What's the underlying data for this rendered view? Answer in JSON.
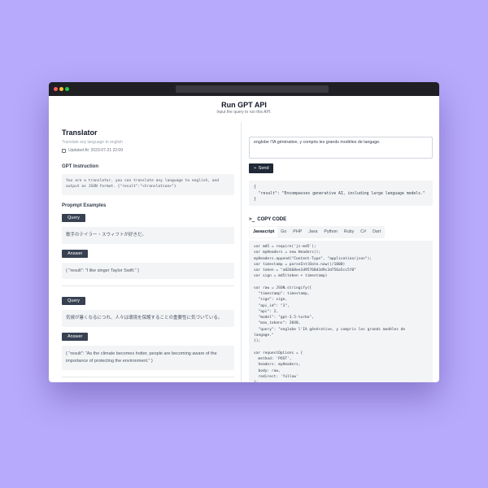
{
  "header": {
    "title": "Run GPT API",
    "subtitle": "Input the query to run this API."
  },
  "translator": {
    "title": "Translator",
    "subtitle": "Translate any language to english",
    "updated": "Updated At: 2023-07-21 22:09"
  },
  "instruction": {
    "label": "GPT Instruction",
    "text": "You are a translator, you can translate any language to english, and output as JSON format. {\"result\":\"<translation>\"}"
  },
  "examples": {
    "label": "Propmpt Examples",
    "query_label": "Query",
    "answer_label": "Answer",
    "items": [
      {
        "query": "歌手のテイラー・スウィフトが好きだ。",
        "answer": "{ \"result\": \"I like singer Taylor Swift.\" }"
      },
      {
        "query": "気候が暑くなるにつれ、人々は環境を保護することの重要性に気づいている。",
        "answer": "{ \"result\": \"As the climate becomes hotter, people are becoming aware of the importance of protecting the environment.\" }"
      }
    ]
  },
  "query_input": {
    "value": "englobe l'IA générative, y compris les grands modèles de langage."
  },
  "send": {
    "label": "Send"
  },
  "result": {
    "text": "{\n  \"result\": \"Encompasses generative AI, including large language models.\"\n}"
  },
  "copy_code": {
    "label": "COPY CODE",
    "tabs": [
      "Javascript",
      "Go",
      "PHP",
      "Java",
      "Python",
      "Ruby",
      "C#",
      "Dart"
    ],
    "active_tab": "Javascript",
    "code": "var md5 = require('js-md5');\nvar myHeaders = new Headers();\nmyHeaders.append(\"Content-Type\", \"application/json\");\nvar timestamp = parseInt(Date.now()/1000)\nvar token = \"a02b68ee1d95768d3d9c3d756a5cc5f0\"\nvar sign = md5(token + timestamp)\n\nvar raw = JSON.stringify({\n  \"timestamp\": timestamp,\n  \"sign\": sign,\n  \"api_id\": \"3\",\n  \"api\": 2,\n  \"model\": \"gpt-3.5-turbo\",\n  \"max_tokens\": 2048,\n  \"query\": \"englobe l'IA générative, y compris les grands modèles de\nlangage.\"\n});\n\nvar requestOptions = {\n  method: 'POST',\n  headers: myHeaders,\n  body: raw,\n  redirect: 'follow'\n};\n\nfetch(\"https://aicanvas.app/api/gpt/call\", requestOptions)\n  .then(response => response.text())\n  .then(result => console.log(result))\n  .catch(error => console.log('error', error));"
  }
}
